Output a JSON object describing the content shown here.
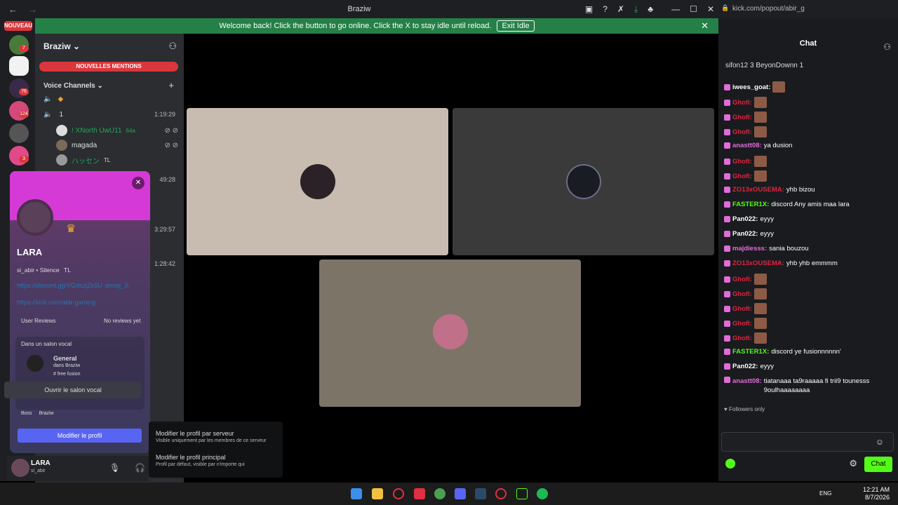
{
  "titlebar": {
    "back": "←",
    "forward": "→",
    "title": "Braziw",
    "icons": [
      "monitor-icon",
      "help-icon",
      "tools-icon",
      "download-icon",
      "nitro-icon"
    ],
    "window_controls": [
      "—",
      "☐",
      "✕"
    ]
  },
  "banner": {
    "text": "Welcome back! Click the button to go online. Click the X to stay idle until reload.",
    "button": "Exit Idle",
    "close": "✕"
  },
  "servers": {
    "nouveau": "NOUVEAU",
    "badges": [
      "7",
      "76",
      "124",
      "3"
    ]
  },
  "sidebar": {
    "server_name": "Braziw",
    "chevron": "⌄",
    "mentions": "NOUVELLES MENTIONS",
    "voice_header": "Voice Channels",
    "channel_1": "1",
    "channel_1_time": "1:19:29",
    "users": [
      {
        "name": "! XNorth UwU11",
        "tag": "64a"
      },
      {
        "name": "magada",
        "tag": ""
      },
      {
        "name": "ハッセン",
        "tag": "TL"
      }
    ],
    "other_times": [
      "49:28",
      "3:29:57",
      "1:28:42"
    ]
  },
  "profile": {
    "display_name": "LARA",
    "username_line": "si_abir • Silence",
    "tag": "TL",
    "link1": "https://discord.gg/VGdszjZk5U :emoji_3:",
    "link2": "https://kick.com/abir-gaming",
    "reviews_label": "User Reviews",
    "reviews_value": "No reviews yet",
    "vc_title": "Dans un salon vocal",
    "vc_channel": "General",
    "vc_server": "dans Braziw",
    "vc_sub": "# free fusion",
    "open_vc": "Ouvrir le salon vocal",
    "roles": [
      "Boss",
      "Braziw"
    ],
    "edit": "Modifier le profil",
    "close": "✕"
  },
  "context_menu": {
    "item1_title": "Modifier le profil par serveur",
    "item1_sub": "Visible uniquement par les membres de ce serveur",
    "item2_title": "Modifier le profil principal",
    "item2_sub": "Profil par défaut, visible par n'importe qui"
  },
  "userpanel": {
    "name": "LARA",
    "status": "si_abir"
  },
  "chat": {
    "url": "kick.com/popout/abir_g",
    "header": "Chat",
    "top_users": "sifon12 3      BeyonDownn 1",
    "messages": [
      {
        "user": "iwees_goat:",
        "color": "#ffffff",
        "text": "",
        "emote": true
      },
      {
        "user": "Ghofi:",
        "color": "#e0243e",
        "text": "",
        "emote": true
      },
      {
        "user": "Ghofi:",
        "color": "#e0243e",
        "text": "",
        "emote": true
      },
      {
        "user": "Ghofi:",
        "color": "#e0243e",
        "text": "",
        "emote": true
      },
      {
        "user": "anastt08:",
        "color": "#e36bd8",
        "text": "ya dusion",
        "emote": false
      },
      {
        "user": "Ghofi:",
        "color": "#e0243e",
        "text": "",
        "emote": true
      },
      {
        "user": "Ghofi:",
        "color": "#e0243e",
        "text": "",
        "emote": true
      },
      {
        "user": "ZO13xOUSEMA:",
        "color": "#e0243e",
        "text": "yhb bizou",
        "emote": false
      },
      {
        "user": "FASTER1X:",
        "color": "#53fc18",
        "text": "discord Any amis maa lara",
        "emote": false
      },
      {
        "user": "Pan022:",
        "color": "#ffffff",
        "text": "eyyy",
        "emote": false
      },
      {
        "user": "Pan022:",
        "color": "#ffffff",
        "text": "eyyy",
        "emote": false
      },
      {
        "user": "majdiesss:",
        "color": "#e36bd8",
        "text": "sania bouzou",
        "emote": false
      },
      {
        "user": "ZO13xOUSEMA:",
        "color": "#e0243e",
        "text": "yhb yhb emmmm",
        "emote": false
      },
      {
        "user": "Ghofi:",
        "color": "#e0243e",
        "text": "",
        "emote": true
      },
      {
        "user": "Ghofi:",
        "color": "#e0243e",
        "text": "",
        "emote": true
      },
      {
        "user": "Ghofi:",
        "color": "#e0243e",
        "text": "",
        "emote": true
      },
      {
        "user": "Ghofi:",
        "color": "#e0243e",
        "text": "",
        "emote": true
      },
      {
        "user": "Ghofi:",
        "color": "#e0243e",
        "text": "",
        "emote": true
      },
      {
        "user": "FASTER1X:",
        "color": "#53fc18",
        "text": "discord ye fusionnnnnn'",
        "emote": false
      },
      {
        "user": "Pan022:",
        "color": "#ffffff",
        "text": "eyyy",
        "emote": false
      },
      {
        "user": "anastt08:",
        "color": "#e36bd8",
        "text": "tiatanaaa ta9raaaaa fi trii9 tounesss 9oulhaaaaaaaa",
        "emote": false
      }
    ],
    "followers_only": "Followers only",
    "send": "Chat"
  },
  "taskbar": {
    "lang": "ENG",
    "time": "12:21 AM",
    "date": "8/7/2026"
  },
  "colors": {
    "accent": "#5865f2",
    "kick_green": "#53fc18",
    "mention_red": "#da373c",
    "banner_green": "#248046"
  }
}
